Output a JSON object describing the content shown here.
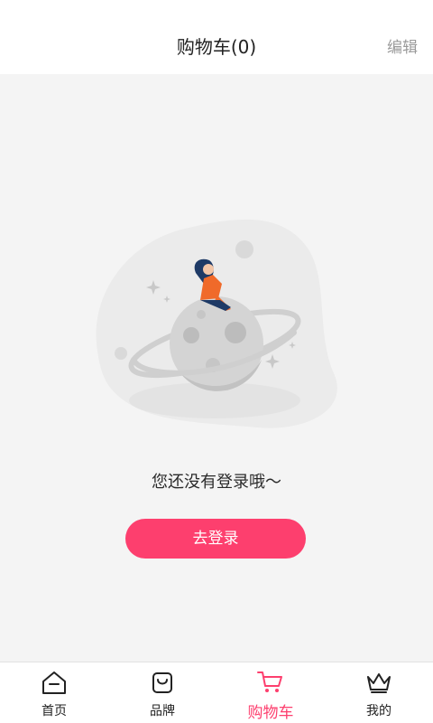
{
  "header": {
    "title": "购物车(0)",
    "edit_label": "编辑"
  },
  "empty_state": {
    "message": "您还没有登录哦～",
    "login_label": "去登录"
  },
  "tabbar": {
    "items": [
      {
        "label": "首页",
        "icon": "home-icon"
      },
      {
        "label": "品牌",
        "icon": "bag-icon"
      },
      {
        "label": "购物车",
        "icon": "cart-icon",
        "active": true
      },
      {
        "label": "我的",
        "icon": "crown-icon"
      }
    ]
  },
  "colors": {
    "accent": "#fd3f6e",
    "background": "#f4f4f4",
    "figure_shirt": "#f06a2a",
    "figure_hair": "#1e3a66"
  }
}
